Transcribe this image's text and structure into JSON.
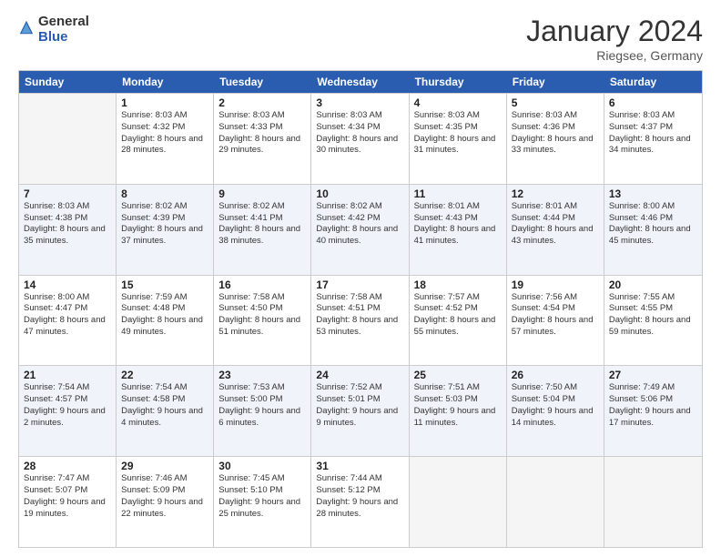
{
  "header": {
    "logo_general": "General",
    "logo_blue": "Blue",
    "month_title": "January 2024",
    "location": "Riegsee, Germany"
  },
  "days": [
    "Sunday",
    "Monday",
    "Tuesday",
    "Wednesday",
    "Thursday",
    "Friday",
    "Saturday"
  ],
  "weeks": [
    [
      {
        "date": "",
        "sunrise": "",
        "sunset": "",
        "daylight": ""
      },
      {
        "date": "1",
        "sunrise": "Sunrise: 8:03 AM",
        "sunset": "Sunset: 4:32 PM",
        "daylight": "Daylight: 8 hours and 28 minutes."
      },
      {
        "date": "2",
        "sunrise": "Sunrise: 8:03 AM",
        "sunset": "Sunset: 4:33 PM",
        "daylight": "Daylight: 8 hours and 29 minutes."
      },
      {
        "date": "3",
        "sunrise": "Sunrise: 8:03 AM",
        "sunset": "Sunset: 4:34 PM",
        "daylight": "Daylight: 8 hours and 30 minutes."
      },
      {
        "date": "4",
        "sunrise": "Sunrise: 8:03 AM",
        "sunset": "Sunset: 4:35 PM",
        "daylight": "Daylight: 8 hours and 31 minutes."
      },
      {
        "date": "5",
        "sunrise": "Sunrise: 8:03 AM",
        "sunset": "Sunset: 4:36 PM",
        "daylight": "Daylight: 8 hours and 33 minutes."
      },
      {
        "date": "6",
        "sunrise": "Sunrise: 8:03 AM",
        "sunset": "Sunset: 4:37 PM",
        "daylight": "Daylight: 8 hours and 34 minutes."
      }
    ],
    [
      {
        "date": "7",
        "sunrise": "Sunrise: 8:03 AM",
        "sunset": "Sunset: 4:38 PM",
        "daylight": "Daylight: 8 hours and 35 minutes."
      },
      {
        "date": "8",
        "sunrise": "Sunrise: 8:02 AM",
        "sunset": "Sunset: 4:39 PM",
        "daylight": "Daylight: 8 hours and 37 minutes."
      },
      {
        "date": "9",
        "sunrise": "Sunrise: 8:02 AM",
        "sunset": "Sunset: 4:41 PM",
        "daylight": "Daylight: 8 hours and 38 minutes."
      },
      {
        "date": "10",
        "sunrise": "Sunrise: 8:02 AM",
        "sunset": "Sunset: 4:42 PM",
        "daylight": "Daylight: 8 hours and 40 minutes."
      },
      {
        "date": "11",
        "sunrise": "Sunrise: 8:01 AM",
        "sunset": "Sunset: 4:43 PM",
        "daylight": "Daylight: 8 hours and 41 minutes."
      },
      {
        "date": "12",
        "sunrise": "Sunrise: 8:01 AM",
        "sunset": "Sunset: 4:44 PM",
        "daylight": "Daylight: 8 hours and 43 minutes."
      },
      {
        "date": "13",
        "sunrise": "Sunrise: 8:00 AM",
        "sunset": "Sunset: 4:46 PM",
        "daylight": "Daylight: 8 hours and 45 minutes."
      }
    ],
    [
      {
        "date": "14",
        "sunrise": "Sunrise: 8:00 AM",
        "sunset": "Sunset: 4:47 PM",
        "daylight": "Daylight: 8 hours and 47 minutes."
      },
      {
        "date": "15",
        "sunrise": "Sunrise: 7:59 AM",
        "sunset": "Sunset: 4:48 PM",
        "daylight": "Daylight: 8 hours and 49 minutes."
      },
      {
        "date": "16",
        "sunrise": "Sunrise: 7:58 AM",
        "sunset": "Sunset: 4:50 PM",
        "daylight": "Daylight: 8 hours and 51 minutes."
      },
      {
        "date": "17",
        "sunrise": "Sunrise: 7:58 AM",
        "sunset": "Sunset: 4:51 PM",
        "daylight": "Daylight: 8 hours and 53 minutes."
      },
      {
        "date": "18",
        "sunrise": "Sunrise: 7:57 AM",
        "sunset": "Sunset: 4:52 PM",
        "daylight": "Daylight: 8 hours and 55 minutes."
      },
      {
        "date": "19",
        "sunrise": "Sunrise: 7:56 AM",
        "sunset": "Sunset: 4:54 PM",
        "daylight": "Daylight: 8 hours and 57 minutes."
      },
      {
        "date": "20",
        "sunrise": "Sunrise: 7:55 AM",
        "sunset": "Sunset: 4:55 PM",
        "daylight": "Daylight: 8 hours and 59 minutes."
      }
    ],
    [
      {
        "date": "21",
        "sunrise": "Sunrise: 7:54 AM",
        "sunset": "Sunset: 4:57 PM",
        "daylight": "Daylight: 9 hours and 2 minutes."
      },
      {
        "date": "22",
        "sunrise": "Sunrise: 7:54 AM",
        "sunset": "Sunset: 4:58 PM",
        "daylight": "Daylight: 9 hours and 4 minutes."
      },
      {
        "date": "23",
        "sunrise": "Sunrise: 7:53 AM",
        "sunset": "Sunset: 5:00 PM",
        "daylight": "Daylight: 9 hours and 6 minutes."
      },
      {
        "date": "24",
        "sunrise": "Sunrise: 7:52 AM",
        "sunset": "Sunset: 5:01 PM",
        "daylight": "Daylight: 9 hours and 9 minutes."
      },
      {
        "date": "25",
        "sunrise": "Sunrise: 7:51 AM",
        "sunset": "Sunset: 5:03 PM",
        "daylight": "Daylight: 9 hours and 11 minutes."
      },
      {
        "date": "26",
        "sunrise": "Sunrise: 7:50 AM",
        "sunset": "Sunset: 5:04 PM",
        "daylight": "Daylight: 9 hours and 14 minutes."
      },
      {
        "date": "27",
        "sunrise": "Sunrise: 7:49 AM",
        "sunset": "Sunset: 5:06 PM",
        "daylight": "Daylight: 9 hours and 17 minutes."
      }
    ],
    [
      {
        "date": "28",
        "sunrise": "Sunrise: 7:47 AM",
        "sunset": "Sunset: 5:07 PM",
        "daylight": "Daylight: 9 hours and 19 minutes."
      },
      {
        "date": "29",
        "sunrise": "Sunrise: 7:46 AM",
        "sunset": "Sunset: 5:09 PM",
        "daylight": "Daylight: 9 hours and 22 minutes."
      },
      {
        "date": "30",
        "sunrise": "Sunrise: 7:45 AM",
        "sunset": "Sunset: 5:10 PM",
        "daylight": "Daylight: 9 hours and 25 minutes."
      },
      {
        "date": "31",
        "sunrise": "Sunrise: 7:44 AM",
        "sunset": "Sunset: 5:12 PM",
        "daylight": "Daylight: 9 hours and 28 minutes."
      },
      {
        "date": "",
        "sunrise": "",
        "sunset": "",
        "daylight": ""
      },
      {
        "date": "",
        "sunrise": "",
        "sunset": "",
        "daylight": ""
      },
      {
        "date": "",
        "sunrise": "",
        "sunset": "",
        "daylight": ""
      }
    ]
  ]
}
